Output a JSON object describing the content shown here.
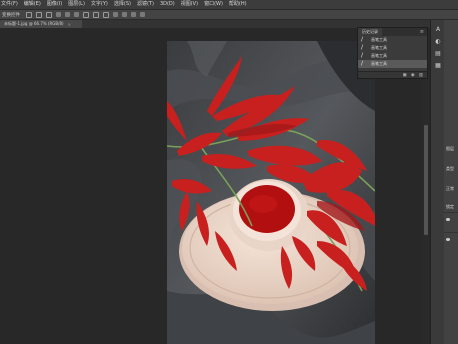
{
  "menu": [
    "文件(F)",
    "编辑(E)",
    "图像(I)",
    "图层(L)",
    "文字(Y)",
    "选择(S)",
    "滤镜(T)",
    "3D(D)",
    "视图(V)",
    "窗口(W)",
    "帮助(H)"
  ],
  "options_bar": {
    "label": "变换控件"
  },
  "document_tab": {
    "title": "未标题-1.jpg @ 66.7% (RGB/8)",
    "close": "×"
  },
  "history_panel": {
    "tab": "历史记录",
    "menu_icon": "≡",
    "items": [
      {
        "label": "画笔工具",
        "icon": "brush-icon"
      },
      {
        "label": "画笔工具",
        "icon": "brush-icon"
      },
      {
        "label": "画笔工具",
        "icon": "brush-icon"
      },
      {
        "label": "画笔工具",
        "icon": "brush-icon",
        "selected": true
      }
    ],
    "footer_icons": [
      "new-document-from-state-icon",
      "snapshot-icon",
      "trash-icon"
    ]
  },
  "right_strip_icons": [
    "color-icon",
    "adjustments-icon",
    "libraries-icon",
    "styles-icon"
  ],
  "side_panel": {
    "tab_1": "图层",
    "tab_2": "类型",
    "label_3": "正常",
    "label_4": "锁定"
  }
}
